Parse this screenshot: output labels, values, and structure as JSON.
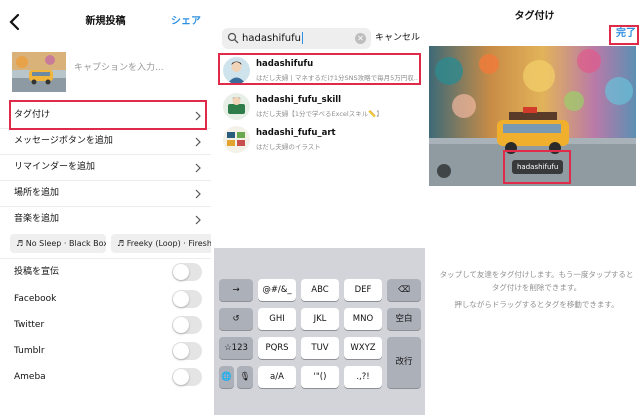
{
  "panel1": {
    "title": "新規投稿",
    "share": "シェア",
    "caption_placeholder": "キャプションを入力...",
    "rows": [
      {
        "label": "タグ付け"
      },
      {
        "label": "メッセージボタンを追加"
      },
      {
        "label": "リマインダーを追加"
      },
      {
        "label": "場所を追加"
      },
      {
        "label": "音楽を追加"
      }
    ],
    "music_chips": [
      "♬ No Sleep · Black Box",
      "♬ Freeky (Loop) · Fireshi"
    ],
    "toggles": [
      {
        "label": "投稿を宣伝",
        "on": false
      },
      {
        "label": "Facebook",
        "on": false
      },
      {
        "label": "Twitter",
        "on": false
      },
      {
        "label": "Tumblr",
        "on": false
      },
      {
        "label": "Ameba",
        "on": false
      }
    ]
  },
  "panel2": {
    "search_value": "hadashifufu",
    "cancel": "キャンセル",
    "results": [
      {
        "username": "hadashifufu",
        "sub": "はだし夫婦丨マネするだけ1分SNS攻略で毎月5万円収..."
      },
      {
        "username": "hadashi_fufu_skill",
        "sub": "はだし夫婦【1分で学べるExcelスキル📏】"
      },
      {
        "username": "hadashi_fufu_art",
        "sub": "はだし夫婦のイラスト"
      }
    ],
    "keyboard": {
      "row1": [
        "→",
        "@#/&_",
        "ABC",
        "DEF",
        "⌫"
      ],
      "row2": [
        "↺",
        "GHI",
        "JKL",
        "MNO",
        "空白"
      ],
      "row3": [
        "☆123",
        "PQRS",
        "TUV",
        "WXYZ",
        "改行"
      ],
      "row4": [
        "🌐",
        "🎙",
        "a/A",
        "'\"()",
        ".,?!"
      ]
    }
  },
  "panel3": {
    "title": "タグ付け",
    "done": "完了",
    "tag_label": "hadashifufu",
    "info1": "タップして友達をタグ付けします。もう一度タップするとタグ付けを削除できます。",
    "info2": "押しながらドラッグするとタグを移動できます。"
  },
  "colors": {
    "accent": "#2f8fe0",
    "highlight": "#e02a4a"
  }
}
